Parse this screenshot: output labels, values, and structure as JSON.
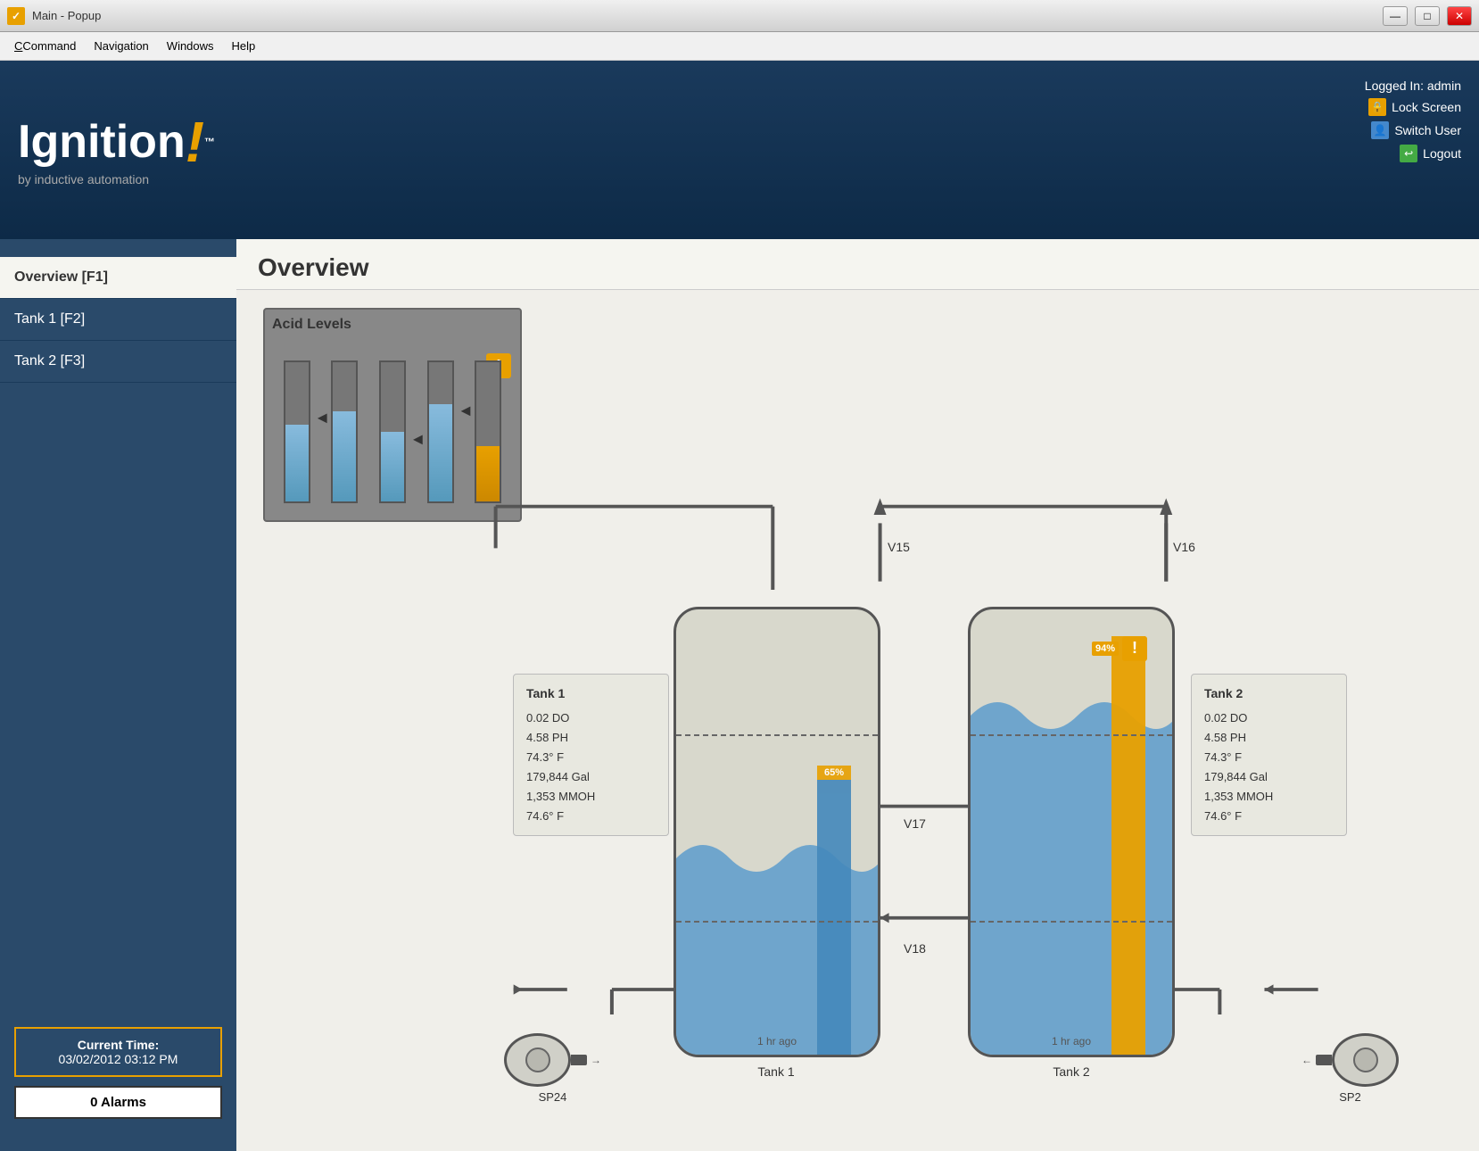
{
  "titlebar": {
    "title": "Main - Popup",
    "minimize_label": "—",
    "maximize_label": "□",
    "close_label": "✕"
  },
  "menubar": {
    "items": [
      {
        "label": "Command",
        "underline": "C",
        "id": "command"
      },
      {
        "label": "Navigation",
        "underline": "N",
        "id": "navigation"
      },
      {
        "label": "Windows",
        "underline": "W",
        "id": "windows"
      },
      {
        "label": "Help",
        "underline": "H",
        "id": "help"
      }
    ]
  },
  "header": {
    "logo_text": "Ignition",
    "logo_subtitle": "by inductive automation",
    "logo_tm": "™",
    "logged_in_label": "Logged In: admin",
    "lock_screen_label": "Lock Screen",
    "switch_user_label": "Switch User",
    "logout_label": "Logout"
  },
  "sidebar": {
    "nav_items": [
      {
        "label": "Overview [F1]",
        "id": "overview",
        "active": true
      },
      {
        "label": "Tank 1 [F2]",
        "id": "tank1",
        "active": false
      },
      {
        "label": "Tank 2 [F3]",
        "id": "tank2",
        "active": false
      }
    ],
    "current_time_label": "Current Time:",
    "current_time_value": "03/02/2012 03:12 PM",
    "alarms_label": "0 Alarms"
  },
  "overview": {
    "title": "Overview",
    "acid_levels": {
      "title": "Acid Levels",
      "bars": [
        {
          "fill": 55
        },
        {
          "fill": 65
        },
        {
          "fill": 50
        },
        {
          "fill": 70
        },
        {
          "fill": 40,
          "warning": true
        }
      ]
    },
    "tank1": {
      "label": "Tank 1",
      "do": "0.02 DO",
      "ph": "4.58 PH",
      "temp": "74.3° F",
      "gal": "179,844 Gal",
      "mmoh": "1,353 MMOH",
      "temp2": "74.6° F",
      "fill_pct": 65,
      "bottom_label": "Tank 1",
      "time_label": "1 hr ago"
    },
    "tank2": {
      "label": "Tank 2",
      "do": "0.02 DO",
      "ph": "4.58 PH",
      "temp": "74.3° F",
      "gal": "179,844 Gal",
      "mmoh": "1,353 MMOH",
      "temp2": "74.6° F",
      "fill_pct": 94,
      "bottom_label": "Tank 2",
      "time_label": "1 hr ago",
      "warning": true
    },
    "valves": {
      "v15": "V15",
      "v16": "V16",
      "v17": "V17",
      "v18": "V18"
    },
    "pumps": {
      "sp24": "SP24",
      "sp2": "SP2"
    }
  }
}
